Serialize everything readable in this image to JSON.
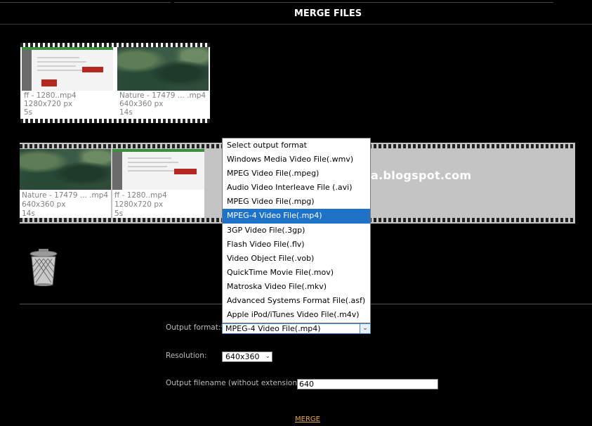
{
  "page": {
    "title": "MERGE FILES",
    "watermark": "kafesia.blogspot.com"
  },
  "source_clips": [
    {
      "name": "ff - 1280..mp4",
      "resolution": "1280x720 px",
      "duration": "5s",
      "thumb": "web-page"
    },
    {
      "name": "Nature - 17479 ... .mp4",
      "resolution": "640x360 px",
      "duration": "14s",
      "thumb": "nature"
    }
  ],
  "merge_clips": [
    {
      "name": "Nature - 17479 ... .mp4",
      "resolution": "640x360 px",
      "duration": "14s",
      "thumb": "nature"
    },
    {
      "name": "ff - 1280..mp4",
      "resolution": "1280x720 px",
      "duration": "5s",
      "thumb": "web-page"
    }
  ],
  "trash": {
    "icon": "trash-can-icon"
  },
  "form": {
    "output_format_label": "Output format:*",
    "output_format_value": "MPEG-4 Video File(.mp4)",
    "output_format_options": [
      "Select output format",
      "Windows Media Video File(.wmv)",
      "MPEG Video File(.mpeg)",
      "Audio Video Interleave File (.avi)",
      "MPEG Video File(.mpg)",
      "MPEG-4 Video File(.mp4)",
      "3GP Video File(.3gp)",
      "Flash Video File(.flv)",
      "Video Object File(.vob)",
      "QuickTime Movie File(.mov)",
      "Matroska Video File(.mkv)",
      "Advanced Systems Format File(.asf)",
      "Apple iPod/iTunes Video File(.m4v)"
    ],
    "selected_option_index": 5,
    "resolution_label": "Resolution:",
    "resolution_value": "640x360",
    "filename_label": "Output filename (without extension):*",
    "filename_value": "640",
    "merge_label": "MERGE"
  },
  "colors": {
    "background": "#000000",
    "selected_option": "#1e73c8",
    "merge_link": "#e8a64a"
  }
}
